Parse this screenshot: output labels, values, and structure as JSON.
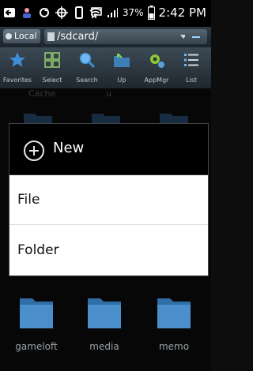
{
  "status_bar": {
    "battery_percent": "37%",
    "clock": "2:42 PM"
  },
  "path_bar": {
    "location_label": "Local",
    "path": "/sdcard/"
  },
  "toolbar": {
    "items": [
      {
        "label": "Favorites",
        "icon": "star-icon"
      },
      {
        "label": "Select",
        "icon": "grid-icon"
      },
      {
        "label": "Search",
        "icon": "magnifier-icon"
      },
      {
        "label": "Up",
        "icon": "folder-up-icon"
      },
      {
        "label": "AppMgr",
        "icon": "gear-icon"
      },
      {
        "label": "List",
        "icon": "list-icon"
      }
    ]
  },
  "background_labels": [
    "Cache",
    "u"
  ],
  "dialog": {
    "title": "New",
    "options": [
      "File",
      "Folder"
    ]
  },
  "folders": [
    {
      "name": "gameloft"
    },
    {
      "name": "media"
    },
    {
      "name": "memo"
    }
  ],
  "colors": {
    "toolbar": "#2e3a44",
    "folder": "#3e7fb8",
    "dialog_header": "#000000"
  }
}
